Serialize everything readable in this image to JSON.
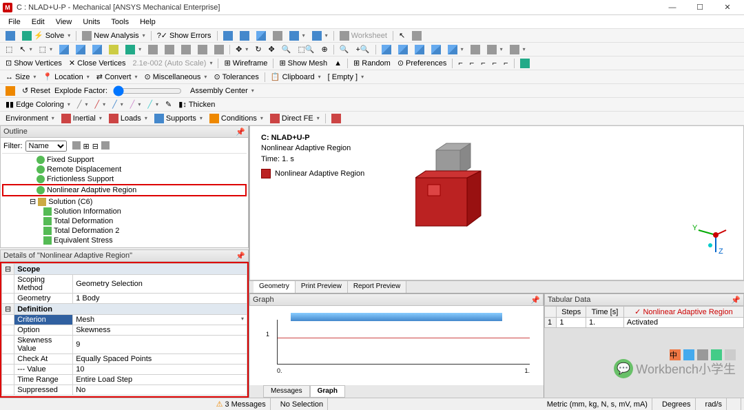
{
  "window": {
    "title": "C : NLAD+U-P - Mechanical [ANSYS Mechanical Enterprise]"
  },
  "menu": [
    "File",
    "Edit",
    "View",
    "Units",
    "Tools",
    "Help"
  ],
  "tb1": {
    "solve": "Solve",
    "new_analysis": "New Analysis",
    "show_errors": "Show Errors",
    "worksheet": "Worksheet"
  },
  "tb3": {
    "show_vertices": "Show Vertices",
    "close_vertices": "Close Vertices",
    "scale": "2.1e-002 (Auto Scale)",
    "wireframe": "Wireframe",
    "show_mesh": "Show Mesh",
    "random": "Random",
    "preferences": "Preferences"
  },
  "tb4": {
    "size": "Size",
    "location": "Location",
    "convert": "Convert",
    "misc": "Miscellaneous",
    "tolerances": "Tolerances",
    "clipboard": "Clipboard",
    "empty": "[ Empty ]"
  },
  "tb5": {
    "reset": "Reset",
    "explode": "Explode Factor:",
    "assembly": "Assembly Center"
  },
  "tb6": {
    "edge": "Edge Coloring",
    "thicken": "Thicken"
  },
  "tb7": {
    "env": "Environment",
    "inertial": "Inertial",
    "loads": "Loads",
    "supports": "Supports",
    "conditions": "Conditions",
    "direct": "Direct FE"
  },
  "outline": {
    "title": "Outline",
    "filter": "Filter:",
    "filter_val": "Name",
    "items": [
      "Fixed Support",
      "Remote Displacement",
      "Frictionless Support",
      "Nonlinear Adaptive Region",
      "Solution (C6)",
      "Solution Information",
      "Total Deformation",
      "Total Deformation 2",
      "Equivalent Stress"
    ]
  },
  "details": {
    "title": "Details of \"Nonlinear Adaptive Region\"",
    "rows": [
      {
        "cat": "Scope"
      },
      {
        "k": "Scoping Method",
        "v": "Geometry Selection"
      },
      {
        "k": "Geometry",
        "v": "1 Body"
      },
      {
        "cat": "Definition"
      },
      {
        "k": "Criterion",
        "v": "Mesh",
        "sel": true,
        "dd": true
      },
      {
        "k": "Option",
        "v": "Skewness"
      },
      {
        "k": "Skewness Value",
        "v": "9"
      },
      {
        "k": "Check At",
        "v": "Equally Spaced Points"
      },
      {
        "k": "--- Value",
        "v": "10"
      },
      {
        "k": "Time Range",
        "v": "Entire Load Step"
      },
      {
        "k": "Suppressed",
        "v": "No"
      }
    ]
  },
  "viewport": {
    "title": "C: NLAD+U-P",
    "sub": "Nonlinear Adaptive Region",
    "time": "Time: 1. s",
    "legend": "Nonlinear Adaptive Region",
    "tabs": [
      "Geometry",
      "Print Preview",
      "Report Preview"
    ]
  },
  "graph": {
    "title": "Graph",
    "x0": "0.",
    "x1": "1.",
    "y": "1"
  },
  "tabular": {
    "title": "Tabular Data",
    "headers": [
      "",
      "Steps",
      "Time [s]",
      "Nonlinear Adaptive Region"
    ],
    "row": [
      "1",
      "1",
      "1.",
      "Activated"
    ]
  },
  "bottom_tabs": [
    "Messages",
    "Graph"
  ],
  "status": {
    "messages": "3 Messages",
    "selection": "No Selection",
    "units": "Metric (mm, kg, N, s, mV, mA)",
    "deg": "Degrees",
    "rad": "rad/s"
  },
  "watermark": {
    "text": "Workbench小学生"
  }
}
